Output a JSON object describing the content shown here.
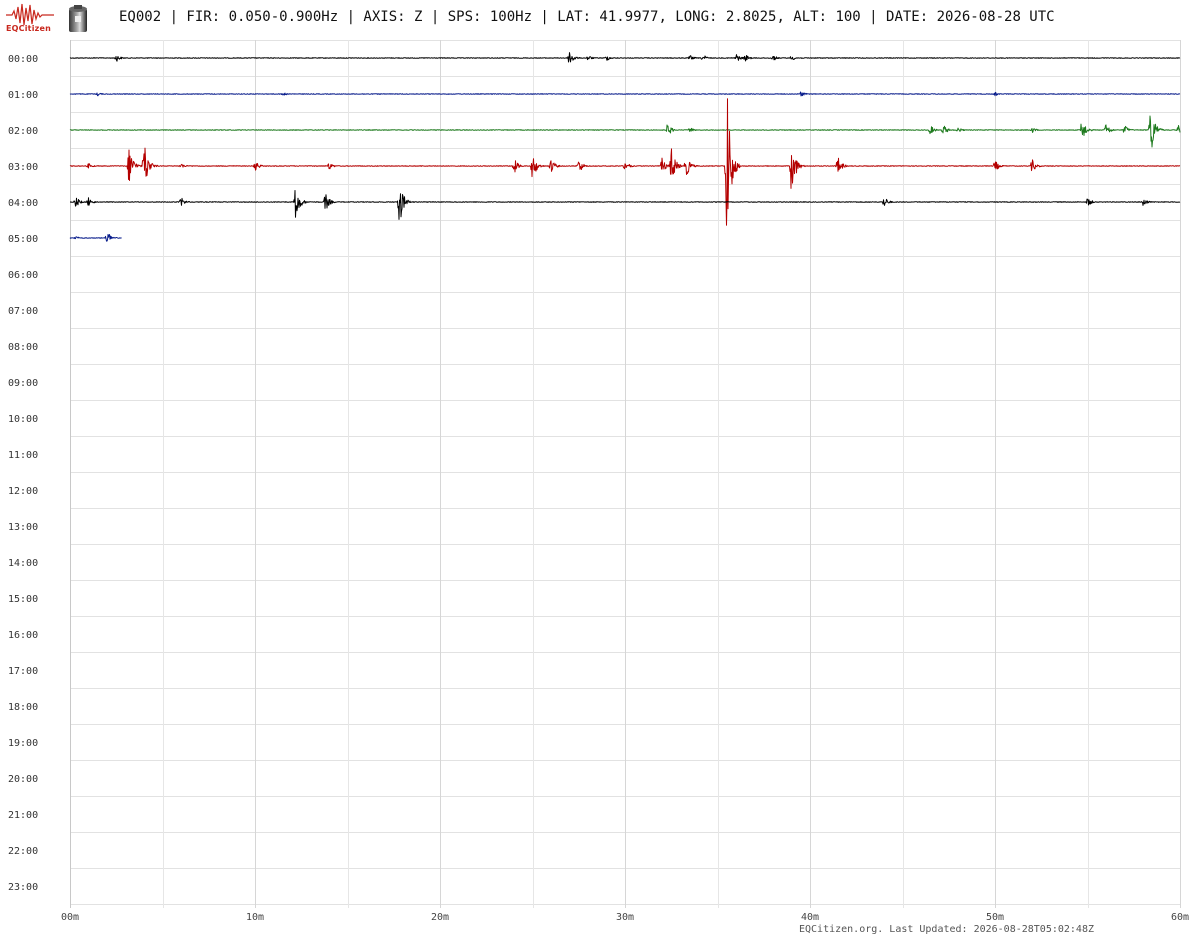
{
  "header": {
    "logo_text": "EQCitizen",
    "title": "EQ002 | FIR: 0.050-0.900Hz | AXIS: Z | SPS: 100Hz | LAT: 41.9977, LONG: 2.8025, ALT: 100 | DATE: 2026-08-28 UTC"
  },
  "footer": {
    "text": "EQCitizen.org. Last Updated: 2026-08-28T05:02:48Z"
  },
  "chart_data": {
    "type": "line",
    "title": "",
    "xlabel": "",
    "ylabel": "",
    "xlim": [
      0,
      60
    ],
    "x_tick_labels": [
      "00m",
      "10m",
      "20m",
      "30m",
      "40m",
      "50m",
      "60m"
    ],
    "row_labels": [
      "00:00",
      "01:00",
      "02:00",
      "03:00",
      "04:00",
      "05:00",
      "06:00",
      "07:00",
      "08:00",
      "09:00",
      "10:00",
      "11:00",
      "12:00",
      "13:00",
      "14:00",
      "15:00",
      "16:00",
      "17:00",
      "18:00",
      "19:00",
      "20:00",
      "21:00",
      "22:00",
      "23:00"
    ],
    "grid": true,
    "colors": [
      "#000000",
      "#0a1e8c",
      "#1e7a1e",
      "#b40000"
    ],
    "series": [
      {
        "row": "00:00",
        "color": "#000000",
        "end_minute": 60,
        "events": [
          [
            2.5,
            4
          ],
          [
            27,
            9
          ],
          [
            28,
            3
          ],
          [
            29,
            3
          ],
          [
            33.5,
            3
          ],
          [
            34.2,
            4
          ],
          [
            36,
            5
          ],
          [
            36.5,
            4
          ],
          [
            38,
            3
          ],
          [
            39,
            3
          ]
        ]
      },
      {
        "row": "01:00",
        "color": "#0a1e8c",
        "end_minute": 60,
        "events": [
          [
            1.5,
            2
          ],
          [
            11.5,
            2
          ],
          [
            39.5,
            3
          ],
          [
            50,
            2
          ]
        ]
      },
      {
        "row": "02:00",
        "color": "#1e7a1e",
        "end_minute": 60,
        "events": [
          [
            32.3,
            7
          ],
          [
            33.5,
            3
          ],
          [
            46.5,
            5
          ],
          [
            47.2,
            6
          ],
          [
            48,
            3
          ],
          [
            52,
            3
          ],
          [
            54.7,
            12
          ],
          [
            56,
            7
          ],
          [
            57,
            5
          ],
          [
            58.4,
            30
          ],
          [
            59.9,
            5
          ]
        ]
      },
      {
        "row": "03:00",
        "color": "#b40000",
        "end_minute": 60,
        "events": [
          [
            1,
            3
          ],
          [
            3.2,
            22
          ],
          [
            4,
            28
          ],
          [
            6,
            3
          ],
          [
            10,
            6
          ],
          [
            14,
            4
          ],
          [
            24,
            8
          ],
          [
            25,
            15
          ],
          [
            26,
            8
          ],
          [
            27.5,
            8
          ],
          [
            30,
            6
          ],
          [
            32,
            8
          ],
          [
            32.5,
            20
          ],
          [
            33.3,
            12
          ],
          [
            35.5,
            91
          ],
          [
            39,
            30
          ],
          [
            41.5,
            10
          ],
          [
            50,
            6
          ],
          [
            52,
            7
          ]
        ]
      },
      {
        "row": "04:00",
        "color": "#000000",
        "end_minute": 60,
        "events": [
          [
            0.3,
            6
          ],
          [
            1,
            5
          ],
          [
            6,
            5
          ],
          [
            12.2,
            20
          ],
          [
            13.8,
            10
          ],
          [
            17.8,
            24
          ],
          [
            44,
            6
          ],
          [
            55,
            5
          ],
          [
            58,
            5
          ]
        ]
      },
      {
        "row": "05:00",
        "color": "#0a1e8c",
        "end_minute": 2.8,
        "events": [
          [
            0.3,
            2
          ],
          [
            2,
            8
          ]
        ]
      }
    ]
  }
}
